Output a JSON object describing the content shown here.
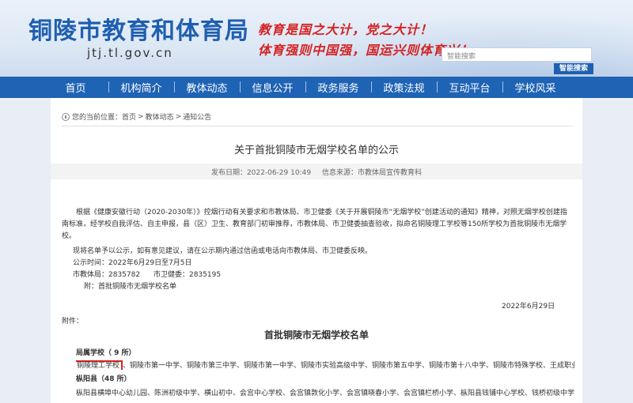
{
  "header": {
    "site_title": "铜陵市教育和体育局",
    "domain": "jtj.tl.gov.cn",
    "slogan_line1": "教育是国之大计，党之大计！",
    "slogan_line2": "体育强则中国强，国运兴则体育兴！",
    "search_placeholder": "智能搜索",
    "search_button": "智能搜索"
  },
  "nav": [
    "首页",
    "机构简介",
    "教体动态",
    "信息公开",
    "政务服务",
    "政策法规",
    "互动平台",
    "学校风采"
  ],
  "breadcrumb": {
    "prefix": "您的当前位置：",
    "items": [
      "首页",
      "教体动态",
      "通知公告"
    ]
  },
  "article": {
    "title": "关于首批铜陵市无烟学校名单的公示",
    "publish_date": "发布日期：2022-06-29 10:49",
    "source": "信息来源：市教体局宣传教育科",
    "paragraph1": "根据《健康安徽行动（2020-2030年）》控烟行动有关要求和市教体局、市卫健委《关于开展铜陵市“无烟学校”创建活动的通知》精神，对照无烟学校创建指南标准，经学校自我评估、自主申报，县（区）卫生、教育部门初审推荐，市教体局、市卫健委抽查验收，拟命名铜陵理工学校等150所学校为首批铜陵市无烟学校。",
    "paragraph2": "现将名单予以公示，如有意见建议，请在公示期内通过信函或电话向市教体局、市卫健委反映。",
    "period": "公示时间：2022年6月29日至7月5日",
    "phone_edu": "市教体局：2835782",
    "phone_health": "市卫健委：2835195",
    "attachment_note": "附：首批铜陵市无烟学校名单",
    "sign_date": "2022年6月29日",
    "attachment_label": "附件："
  },
  "list": {
    "title": "首批铜陵市无烟学校名单",
    "cat1": "局属学校（ 9 所）",
    "cat1_first": "铜陵理工学校",
    "cat1_rest": "、铜陵市第一中学、铜陵市第三中学、铜陵市第一中学、铜陵市实验高级中学、铜陵市第五中学、铜陵市第十八中学、铜陵市特殊学校、王成职业学校",
    "cat2": "枞阳县（48 所）",
    "cat2_row": "枞阳县横埠中心幼儿园、陈洲初级中学、横山初中、会宫中心学校、会宫镇敦化小学、会宫镇晓春小学、会宫镇栏桥小学、枞阳县钱铺中心学校、钱桥初级中学"
  }
}
